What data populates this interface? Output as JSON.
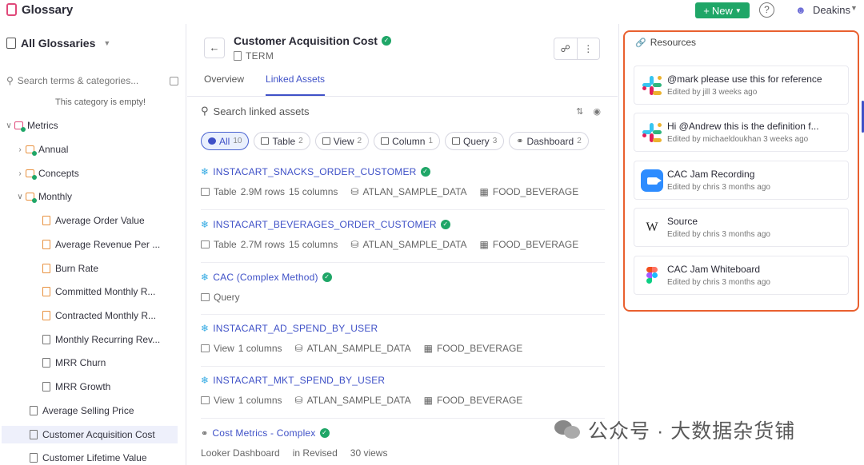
{
  "app": {
    "title": "Glossary",
    "new_label": "New",
    "help_glyph": "?",
    "user": "Deakins"
  },
  "sidebar": {
    "header": "All Glossaries",
    "search_placeholder": "Search terms & categories...",
    "empty_note": "This category is empty!",
    "items": [
      {
        "label": "Metrics",
        "icon": "category-icon-pink",
        "chevron": "expanded"
      },
      {
        "label": "Annual",
        "icon": "folder-icon",
        "chevron": "collapsed"
      },
      {
        "label": "Concepts",
        "icon": "folder-icon",
        "chevron": "collapsed"
      },
      {
        "label": "Monthly",
        "icon": "folder-icon",
        "chevron": "expanded"
      },
      {
        "label": "Average Order Value",
        "icon": "term-icon"
      },
      {
        "label": "Average Revenue Per ...",
        "icon": "term-icon"
      },
      {
        "label": "Burn Rate",
        "icon": "term-icon"
      },
      {
        "label": "Committed Monthly R...",
        "icon": "term-icon"
      },
      {
        "label": "Contracted Monthly R...",
        "icon": "term-icon"
      },
      {
        "label": "Monthly Recurring Rev...",
        "icon": "term-icon"
      },
      {
        "label": "MRR Churn",
        "icon": "term-icon"
      },
      {
        "label": "MRR Growth",
        "icon": "term-icon"
      },
      {
        "label": "Average Selling Price",
        "icon": "term-icon"
      },
      {
        "label": "Customer Acquisition Cost",
        "icon": "term-icon",
        "active": true
      },
      {
        "label": "Customer Lifetime Value",
        "icon": "term-icon"
      }
    ]
  },
  "term": {
    "title": "Customer Acquisition Cost",
    "type_label": "TERM",
    "tabs": [
      "Overview",
      "Linked Assets"
    ],
    "active_tab": "Linked Assets"
  },
  "linked_assets": {
    "search_placeholder": "Search linked assets",
    "filters": [
      {
        "label": "All",
        "count": "10",
        "active": true
      },
      {
        "label": "Table",
        "count": "2"
      },
      {
        "label": "View",
        "count": "2"
      },
      {
        "label": "Column",
        "count": "1"
      },
      {
        "label": "Query",
        "count": "3"
      },
      {
        "label": "Dashboard",
        "count": "2"
      }
    ],
    "assets": [
      {
        "name": "INSTACART_SNACKS_ORDER_CUSTOMER",
        "type": "Table",
        "rows": "2.9M rows",
        "cols": "15 columns",
        "db": "ATLAN_SAMPLE_DATA",
        "schema": "FOOD_BEVERAGE"
      },
      {
        "name": "INSTACART_BEVERAGES_ORDER_CUSTOMER",
        "type": "Table",
        "rows": "2.7M rows",
        "cols": "15 columns",
        "db": "ATLAN_SAMPLE_DATA",
        "schema": "FOOD_BEVERAGE"
      },
      {
        "name": "CAC (Complex Method)",
        "type": "Query"
      },
      {
        "name": "INSTACART_AD_SPEND_BY_USER",
        "type": "View",
        "cols": "1 columns",
        "db": "ATLAN_SAMPLE_DATA",
        "schema": "FOOD_BEVERAGE"
      },
      {
        "name": "INSTACART_MKT_SPEND_BY_USER",
        "type": "View",
        "cols": "1 columns",
        "db": "ATLAN_SAMPLE_DATA",
        "schema": "FOOD_BEVERAGE"
      },
      {
        "name": "Cost Metrics - Complex",
        "type": "Looker Dashboard",
        "folder": "in Revised",
        "views": "30 views"
      }
    ]
  },
  "resources": {
    "title": "Resources",
    "items": [
      {
        "name": "@mark please use this for reference",
        "meta": "Edited by jill 3 weeks ago",
        "icon": "slack-icon"
      },
      {
        "name": "Hi @Andrew this is the definition f...",
        "meta": "Edited by michaeldoukhan 3 weeks ago",
        "icon": "slack-icon"
      },
      {
        "name": "CAC Jam Recording",
        "meta": "Edited by chris 3 months ago",
        "icon": "zoom-icon"
      },
      {
        "name": "Source",
        "meta": "Edited by chris 3 months ago",
        "icon": "wikipedia-icon"
      },
      {
        "name": "CAC Jam Whiteboard",
        "meta": "Edited by chris 3 months ago",
        "icon": "figma-icon"
      }
    ]
  },
  "watermark": {
    "text": "公众号 · 大数据杂货铺"
  },
  "colors": {
    "accent": "#3f51c7",
    "new_button": "#1fa667",
    "resources_outline": "#e9602f",
    "verified": "#1fa667"
  }
}
